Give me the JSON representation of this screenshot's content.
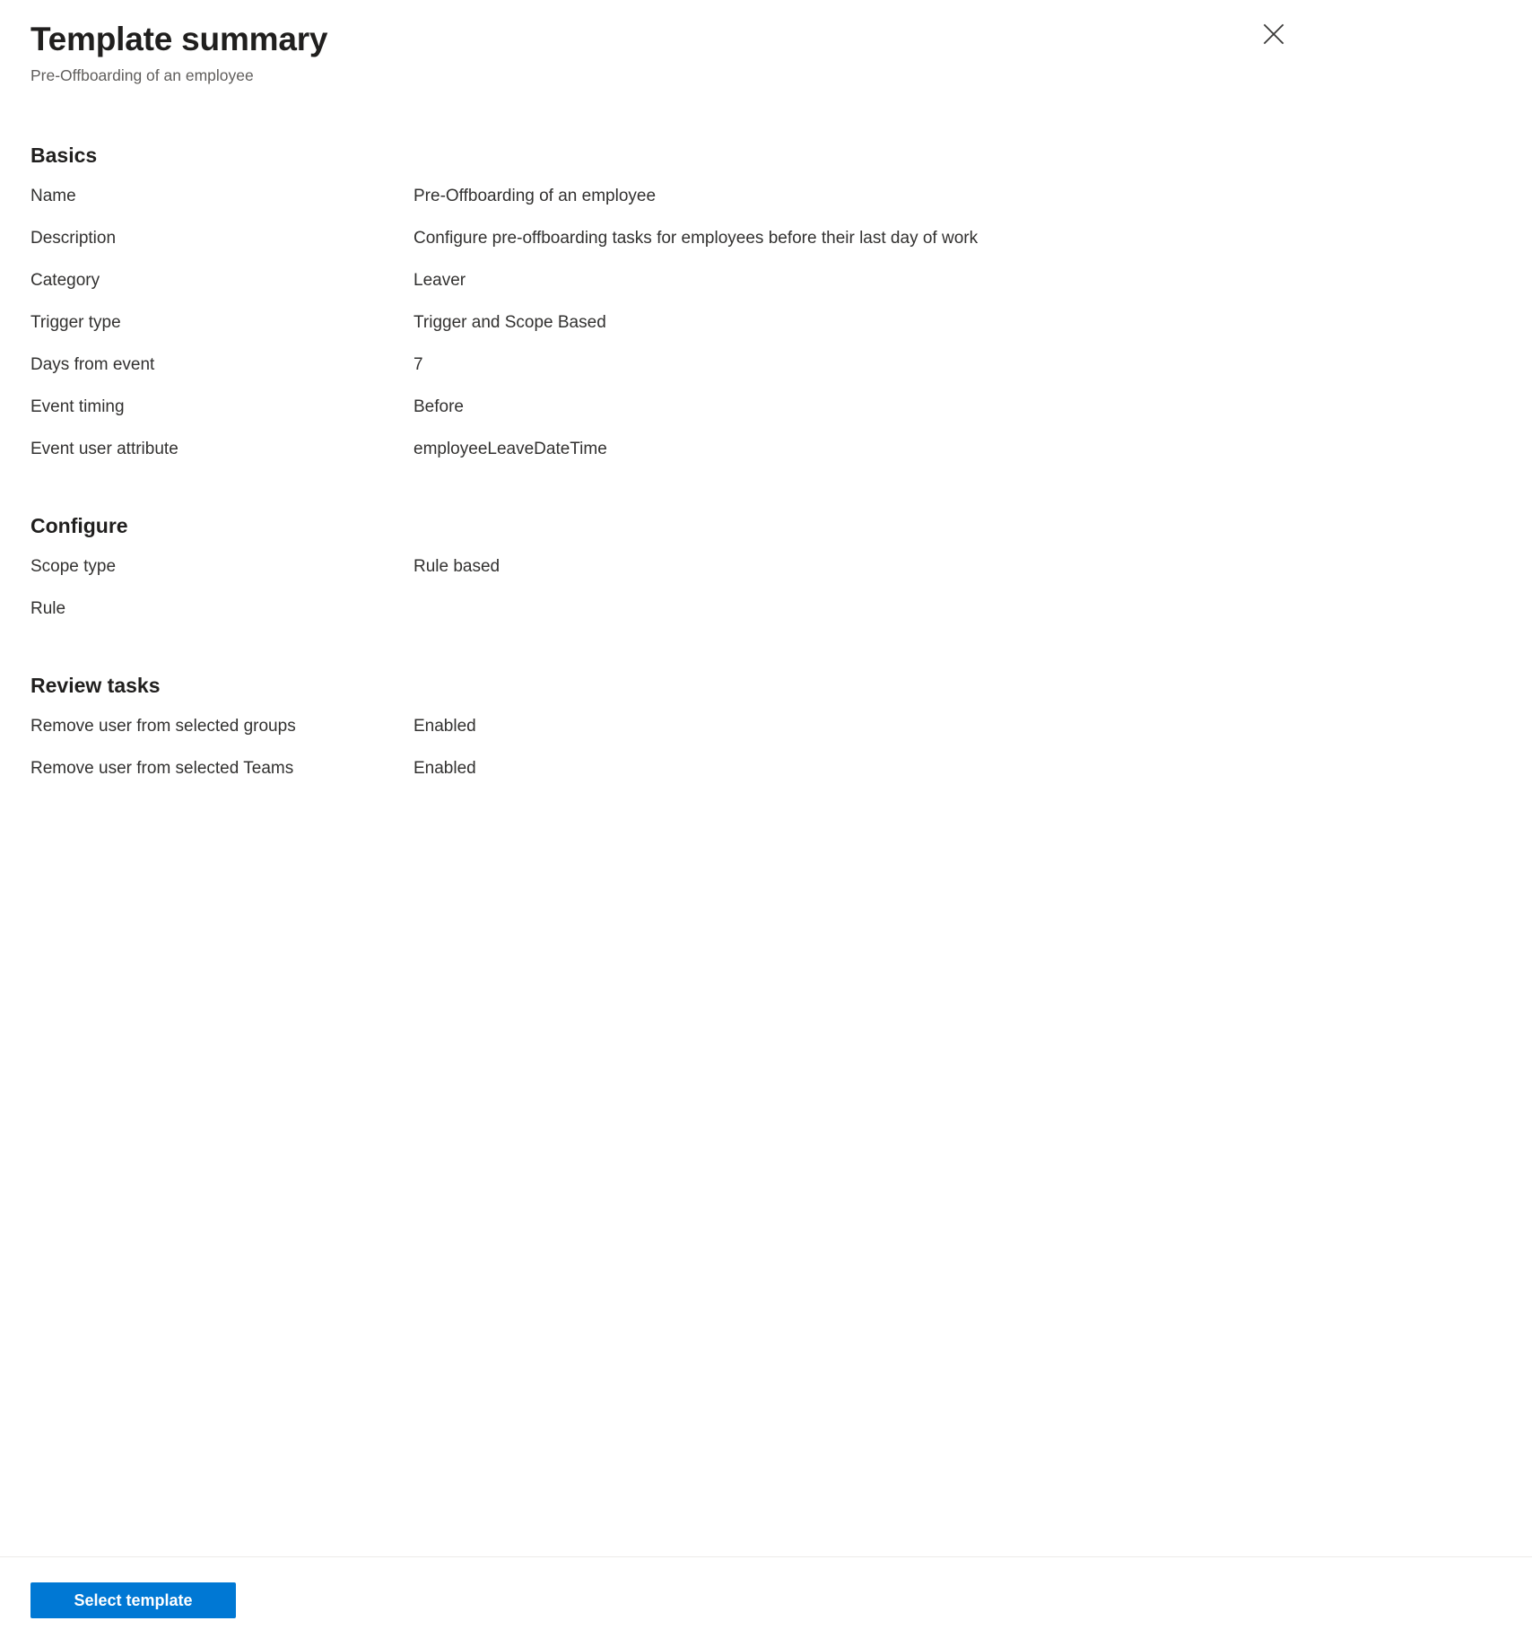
{
  "header": {
    "title": "Template summary",
    "subtitle": "Pre-Offboarding of an employee",
    "close_label": "Close",
    "close_icon": "close-icon"
  },
  "sections": [
    {
      "id": "basics",
      "heading": "Basics",
      "rows": [
        {
          "label": "Name",
          "value": "Pre-Offboarding of an employee"
        },
        {
          "label": "Description",
          "value": "Configure pre-offboarding tasks for employees before their last day of work"
        },
        {
          "label": "Category",
          "value": "Leaver"
        },
        {
          "label": "Trigger type",
          "value": "Trigger and Scope Based"
        },
        {
          "label": "Days from event",
          "value": "7"
        },
        {
          "label": "Event timing",
          "value": "Before"
        },
        {
          "label": "Event user attribute",
          "value": "employeeLeaveDateTime"
        }
      ]
    },
    {
      "id": "configure",
      "heading": "Configure",
      "rows": [
        {
          "label": "Scope type",
          "value": "Rule based"
        },
        {
          "label": "Rule",
          "value": ""
        }
      ]
    },
    {
      "id": "review-tasks",
      "heading": "Review tasks",
      "rows": [
        {
          "label": "Remove user from selected groups",
          "value": "Enabled"
        },
        {
          "label": "Remove user from selected Teams",
          "value": "Enabled"
        }
      ]
    }
  ],
  "footer": {
    "primary_button_label": "Select template"
  },
  "colors": {
    "accent": "#0078d4",
    "text_primary": "#323130",
    "text_heading": "#201f1e",
    "text_secondary": "#605e5c",
    "divider": "#edebe9",
    "background": "#ffffff"
  }
}
